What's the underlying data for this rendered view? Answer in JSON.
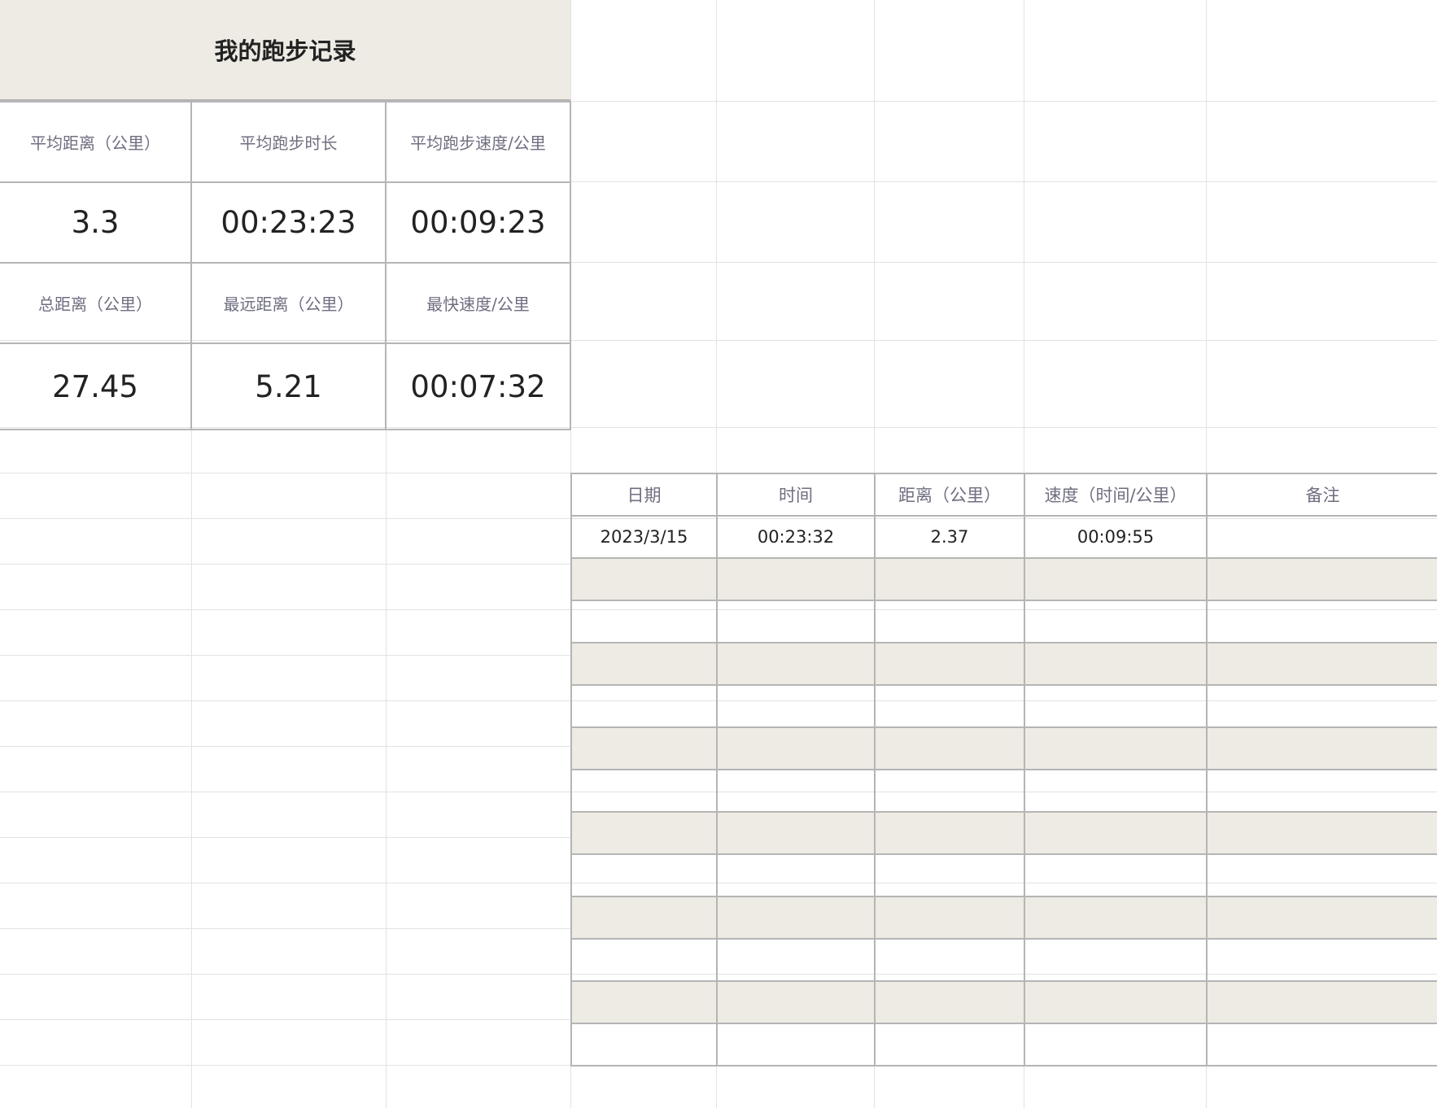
{
  "sheet": {
    "title": "我的跑步记录"
  },
  "summary": {
    "row1_labels": [
      "平均距离（公里）",
      "平均跑步时长",
      "平均跑步速度/公里"
    ],
    "row1_values": [
      "3.3",
      "00:23:23",
      "00:09:23"
    ],
    "row2_labels": [
      "总距离（公里）",
      "最远距离（公里）",
      "最快速度/公里"
    ],
    "row2_values": [
      "27.45",
      "5.21",
      "00:07:32"
    ]
  },
  "records": {
    "headers": [
      "日期",
      "时间",
      "距离（公里）",
      "速度（时间/公里）",
      "备注"
    ],
    "rows": [
      [
        "2023/3/15",
        "00:23:32",
        "2.37",
        "00:09:55",
        ""
      ]
    ],
    "empty_rows": 12
  },
  "colors": {
    "band": "#eeebe4",
    "border": "#b5b5b5",
    "gridline": "#e2e2e2",
    "label_text": "#6e6e80"
  }
}
